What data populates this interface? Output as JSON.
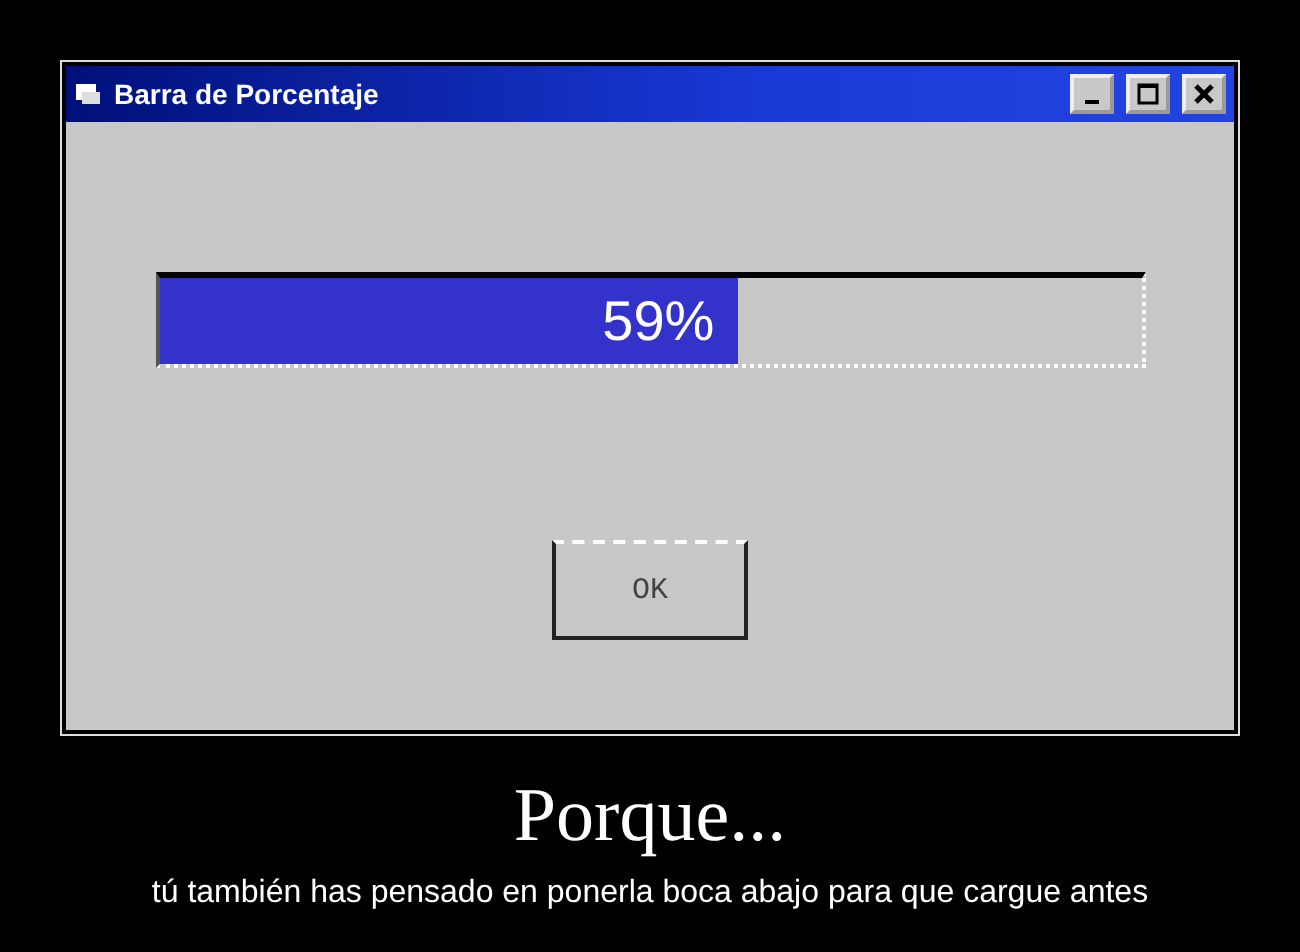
{
  "window": {
    "title": "Barra de Porcentaje"
  },
  "progress": {
    "level": 0.59,
    "reading": "59%"
  },
  "button": {
    "label": "OK"
  },
  "caption": {
    "title": "Porque...",
    "subtitle": "tú también has pensado en ponerla boca abajo para que cargue antes"
  }
}
